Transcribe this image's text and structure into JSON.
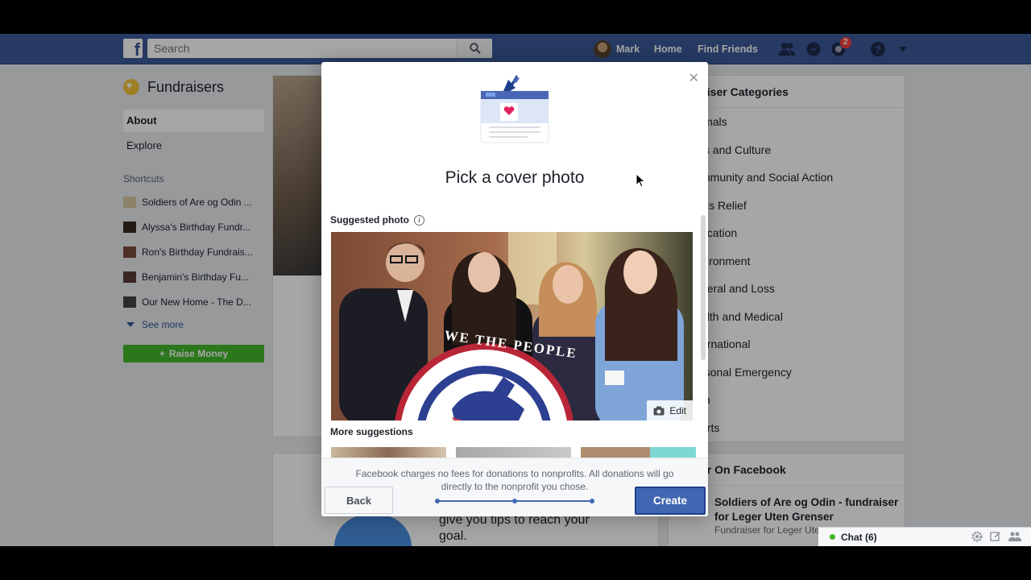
{
  "topbar": {
    "search_placeholder": "Search",
    "user_name": "Mark",
    "home": "Home",
    "find_friends": "Find Friends",
    "notifications_count": "2"
  },
  "left": {
    "title": "Fundraisers",
    "nav": [
      "About",
      "Explore"
    ],
    "shortcuts_heading": "Shortcuts",
    "shortcuts": [
      "Soldiers of Are og Odin ...",
      "Alyssa's Birthday Fundr...",
      "Ron's Birthday Fundrais...",
      "Benjamin's Birthday Fu...",
      "Our New Home - The D..."
    ],
    "see_more": "See more",
    "raise_money": "Raise Money"
  },
  "middle": {
    "tips_text": "give you tips to reach your goal."
  },
  "right": {
    "categories_heading": "aiser Categories",
    "categories": [
      "imals",
      "ts and Culture",
      "mmunity and Social Action",
      "sis Relief",
      "ucation",
      "vironment",
      "neral and Loss",
      "alth and Medical",
      "ernational",
      "rsonal Emergency",
      "th",
      "orts"
    ],
    "popular_heading": "ar On Facebook",
    "popular_title": "Soldiers of Are og Odin - fundraiser for Leger Uten Grenser",
    "popular_sub": "Fundraiser for Leger Ute"
  },
  "chat": {
    "label": "Chat (6)"
  },
  "modal": {
    "title": "Pick a cover photo",
    "suggested_heading": "Suggested photo",
    "edit_label": "Edit",
    "seal_text": "WE THE PEOPLE",
    "more_heading": "More suggestions",
    "fee_text": "Facebook charges no fees for donations to nonprofits. All donations will go directly to the nonprofit you chose.",
    "back_label": "Back",
    "create_label": "Create",
    "progress_step": 3,
    "progress_total": 3
  }
}
